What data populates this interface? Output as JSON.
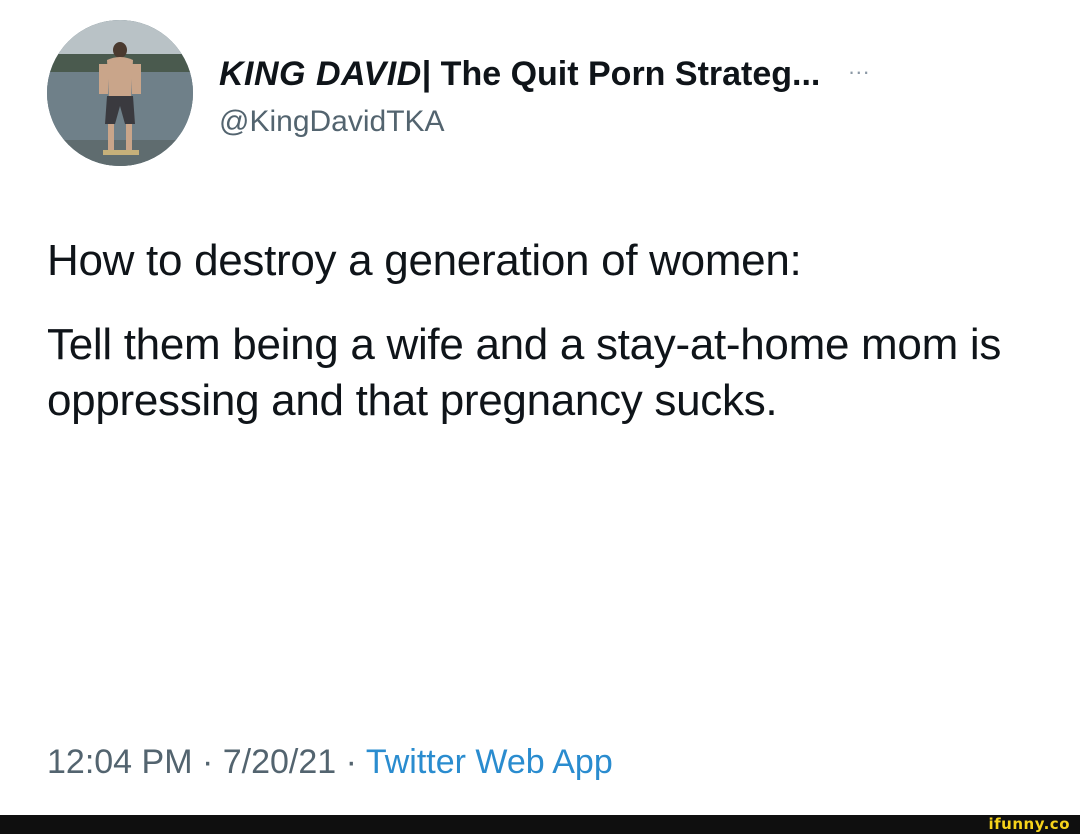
{
  "tweet": {
    "author": {
      "display_name_italic": "KING DAVID",
      "display_name_rest": "| The Quit Porn Strateg...",
      "handle": "@KingDavidTKA",
      "more_label": "···"
    },
    "text_paragraphs": [
      "How to destroy a generation of women:",
      "Tell them being a wife and a stay-at-home mom is oppressing and that pregnancy sucks."
    ],
    "meta": {
      "time": "12:04 PM",
      "sep1": " · ",
      "date": "7/20/21",
      "sep2": " · ",
      "source": "Twitter Web App"
    }
  },
  "watermark": {
    "text": "ifunny.co"
  }
}
